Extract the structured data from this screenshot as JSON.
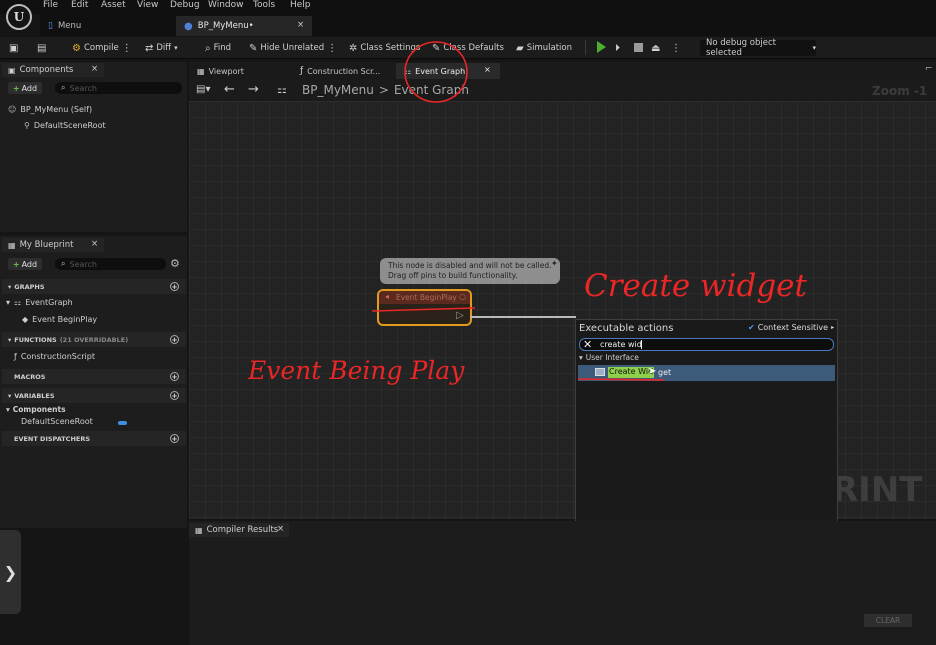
{
  "menubar": {
    "logo_text": "U",
    "items": [
      "File",
      "Edit",
      "Asset",
      "View",
      "Debug",
      "Window",
      "Tools",
      "Help"
    ]
  },
  "document_tabs": [
    {
      "label": "Menu",
      "active": false
    },
    {
      "label": "BP_MyMenu•",
      "active": true,
      "close": "×"
    }
  ],
  "toolbar": {
    "compile": "Compile",
    "diff": "Diff",
    "find": "Find",
    "hide_unrelated": "Hide Unrelated",
    "class_settings": "Class Settings",
    "class_defaults": "Class Defaults",
    "simulation": "Simulation",
    "debug_object": "No debug object selected"
  },
  "components_panel": {
    "title": "Components",
    "close": "×",
    "add": "Add",
    "search_placeholder": "Search",
    "items": [
      "BP_MyMenu (Self)",
      "DefaultSceneRoot"
    ]
  },
  "my_blueprint_panel": {
    "title": "My Blueprint",
    "close": "×",
    "add": "Add",
    "search_placeholder": "Search",
    "graphs_label": "GRAPHS",
    "event_graph": "EventGraph",
    "event_begin_play": "Event BeginPlay",
    "functions_label": "FUNCTIONS",
    "functions_overridable": "(21 OVERRIDABLE)",
    "construction_script": "ConstructionScript",
    "macros_label": "MACROS",
    "variables_label": "VARIABLES",
    "components_label": "Components",
    "default_scene_root": "DefaultSceneRoot",
    "event_dispatchers_label": "EVENT DISPATCHERS"
  },
  "graph_tabs": [
    {
      "label": "Viewport",
      "active": false
    },
    {
      "label": "Construction Scr...",
      "active": false
    },
    {
      "label": "Event Graph",
      "active": true,
      "close": "×"
    }
  ],
  "graph": {
    "breadcrumb_root": "BP_MyMenu",
    "breadcrumb_sep": ">",
    "breadcrumb_current": "Event Graph",
    "zoom": "Zoom -1",
    "watermark": "RINT",
    "node_tooltip_line1": "This node is disabled and will not be called.",
    "node_tooltip_line2": "Drag off pins to build functionality.",
    "node_title": "Event BeginPlay"
  },
  "action_menu": {
    "title": "Executable actions",
    "context_sensitive": "Context Sensitive",
    "search_value": "create wid",
    "category": "User Interface",
    "result_label": "Create Widget",
    "result_highlight": "Create Wid",
    "result_rest": "get"
  },
  "compiler_results": {
    "title": "Compiler Results",
    "close": "×",
    "clear_button": "CLEAR"
  },
  "annotations": {
    "create_widget": "Create widget",
    "event_being_play": "Event Being Play"
  },
  "colors": {
    "annotation_red": "#ea2626",
    "play_green": "#4caf2f",
    "node_orange": "#e39a1e",
    "highlight_green": "#8ed04a",
    "selection_blue": "#3c5a7a"
  },
  "side_toggle": "❯"
}
